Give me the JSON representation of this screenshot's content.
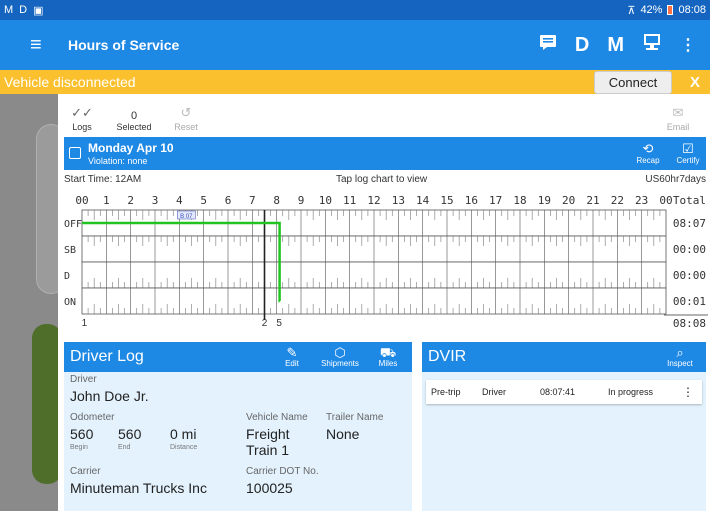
{
  "status_bar": {
    "left_indicators": [
      "M",
      "D"
    ],
    "battery": "42%",
    "time": "08:08"
  },
  "app_bar": {
    "title": "Hours of Service",
    "action_d": "D",
    "action_m": "M"
  },
  "banner": {
    "message": "Vehicle disconnected",
    "connect_label": "Connect",
    "close_label": "X"
  },
  "toolbar": {
    "logs_label": "Logs",
    "selected_count": "0",
    "selected_label": "Selected",
    "reset_label": "Reset",
    "email_label": "Email"
  },
  "day": {
    "date": "Monday Apr 10",
    "violation": "Violation: none",
    "recap_label": "Recap",
    "certify_label": "Certify"
  },
  "chart_info": {
    "start_time": "Start Time: 12AM",
    "hint": "Tap log chart to view",
    "cycle": "US60hr7days"
  },
  "chart_data": {
    "type": "line",
    "hours": [
      "00",
      "1",
      "2",
      "3",
      "4",
      "5",
      "6",
      "7",
      "8",
      "9",
      "10",
      "11",
      "12",
      "13",
      "14",
      "15",
      "16",
      "17",
      "18",
      "19",
      "20",
      "21",
      "22",
      "23",
      "00"
    ],
    "total_label": "Total",
    "statuses": [
      "OFF",
      "SB",
      "D",
      "ON"
    ],
    "totals": [
      "08:07",
      "00:00",
      "00:00",
      "00:01"
    ],
    "grand_total": "08:08",
    "segments": [
      {
        "status": "OFF",
        "start_hour": 0,
        "end_hour": 8.12
      },
      {
        "status": "ON",
        "start_hour": 8.12,
        "end_hour": 8.13
      }
    ],
    "current_hour": 7.5,
    "event_marker": "B 07",
    "bottom_labels": [
      {
        "hour": 0.1,
        "text": "1"
      },
      {
        "hour": 7.5,
        "text": "2"
      },
      {
        "hour": 8.1,
        "text": "5"
      }
    ]
  },
  "driver_log": {
    "title": "Driver Log",
    "edit_label": "Edit",
    "shipments_label": "Shipments",
    "miles_label": "Miles",
    "driver_label": "Driver",
    "driver_name": "John Doe Jr.",
    "odometer_label": "Odometer",
    "odometer_begin": "560",
    "odometer_end": "560",
    "distance": "0 mi",
    "begin_label": "Begin",
    "end_label": "End",
    "distance_label": "Distance",
    "vehicle_name_label": "Vehicle Name",
    "vehicle_name_line1": "Freight",
    "vehicle_name_line2": "Train 1",
    "trailer_name_label": "Trailer Name",
    "trailer_name": "None",
    "carrier_label": "Carrier",
    "carrier": "Minuteman Trucks Inc",
    "carrier_dot_label": "Carrier DOT No.",
    "carrier_dot": "100025"
  },
  "dvir": {
    "title": "DVIR",
    "inspect_label": "Inspect",
    "rows": [
      {
        "type": "Pre-trip",
        "role": "Driver",
        "time": "08:07:41",
        "status": "In progress"
      }
    ]
  }
}
